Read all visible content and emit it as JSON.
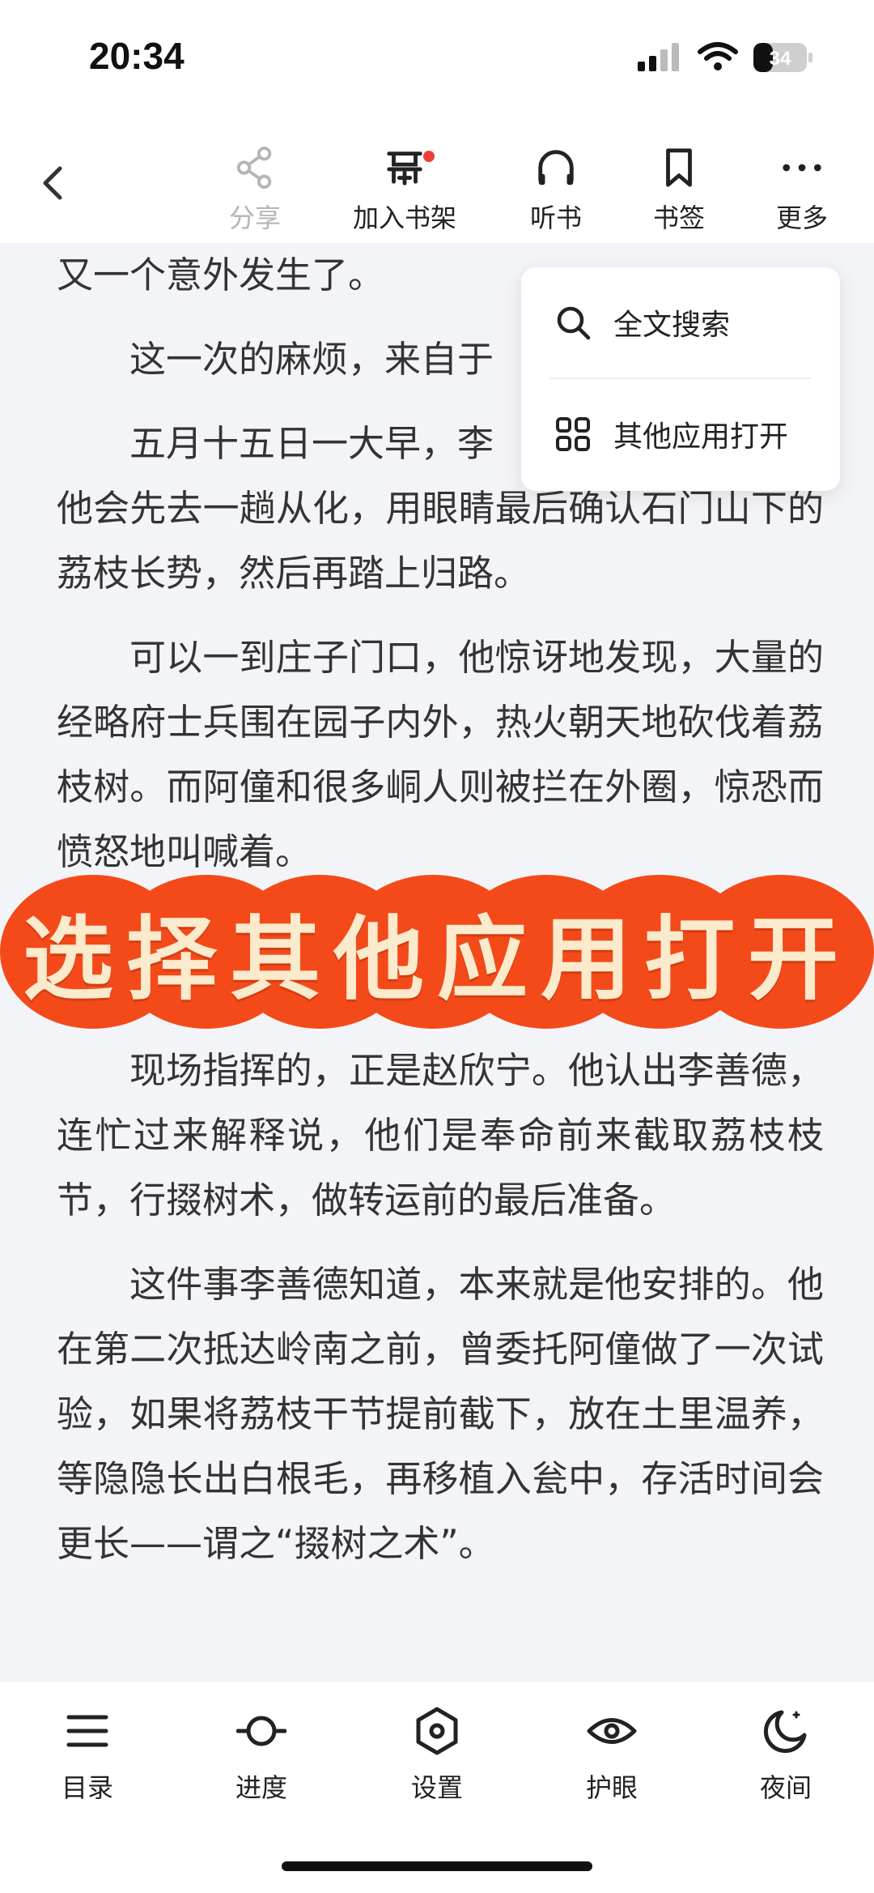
{
  "status_bar": {
    "time": "20:34",
    "battery_level": "34"
  },
  "toolbar": {
    "back_icon": "chevron-left-icon",
    "share_label": "分享",
    "add_shelf_label": "加入书架",
    "listen_label": "听书",
    "bookmark_label": "书签",
    "more_label": "更多",
    "add_shelf_badge_color": "#ef4036"
  },
  "dropdown": {
    "search_label": "全文搜索",
    "open_other_label": "其他应用打开"
  },
  "content": {
    "paragraphs": [
      "又一个意外发生了。",
      "这一次的麻烦，来自于",
      "五月十五日一大早，李",
      "他会先去一趟从化，用眼睛最后确认石门山下的荔枝长势，然后再踏上归路。",
      "可以一到庄子门口，他惊讶地发现，大量的经略府士兵围在园子内外，热火朝天地砍伐着荔枝树。而阿僮和很多峒人则被拦在外圈，惊恐而愤怒地叫喊着。",
      "现场指挥的，正是赵欣宁。他认出李善德，连忙过来解释说，他们是奉命前来截取荔枝枝节，行掇树术，做转运前的最后准备。",
      "这件事李善德知道，本来就是他安排的。他在第二次抵达岭南之前，曾委托阿僮做了一次试验，如果将荔枝干节提前截下，放在土里温养，等隐隐长出白根毛，再移植入瓮中，存活时间会更长——谓之“掇树之术”。"
    ]
  },
  "banner": {
    "text": "选择其他应用打开",
    "bubble_color": "#f44a1a",
    "text_color": "#fbeacc"
  },
  "bottom_bar": {
    "toc_label": "目录",
    "progress_label": "进度",
    "settings_label": "设置",
    "eye_care_label": "护眼",
    "night_label": "夜间"
  }
}
